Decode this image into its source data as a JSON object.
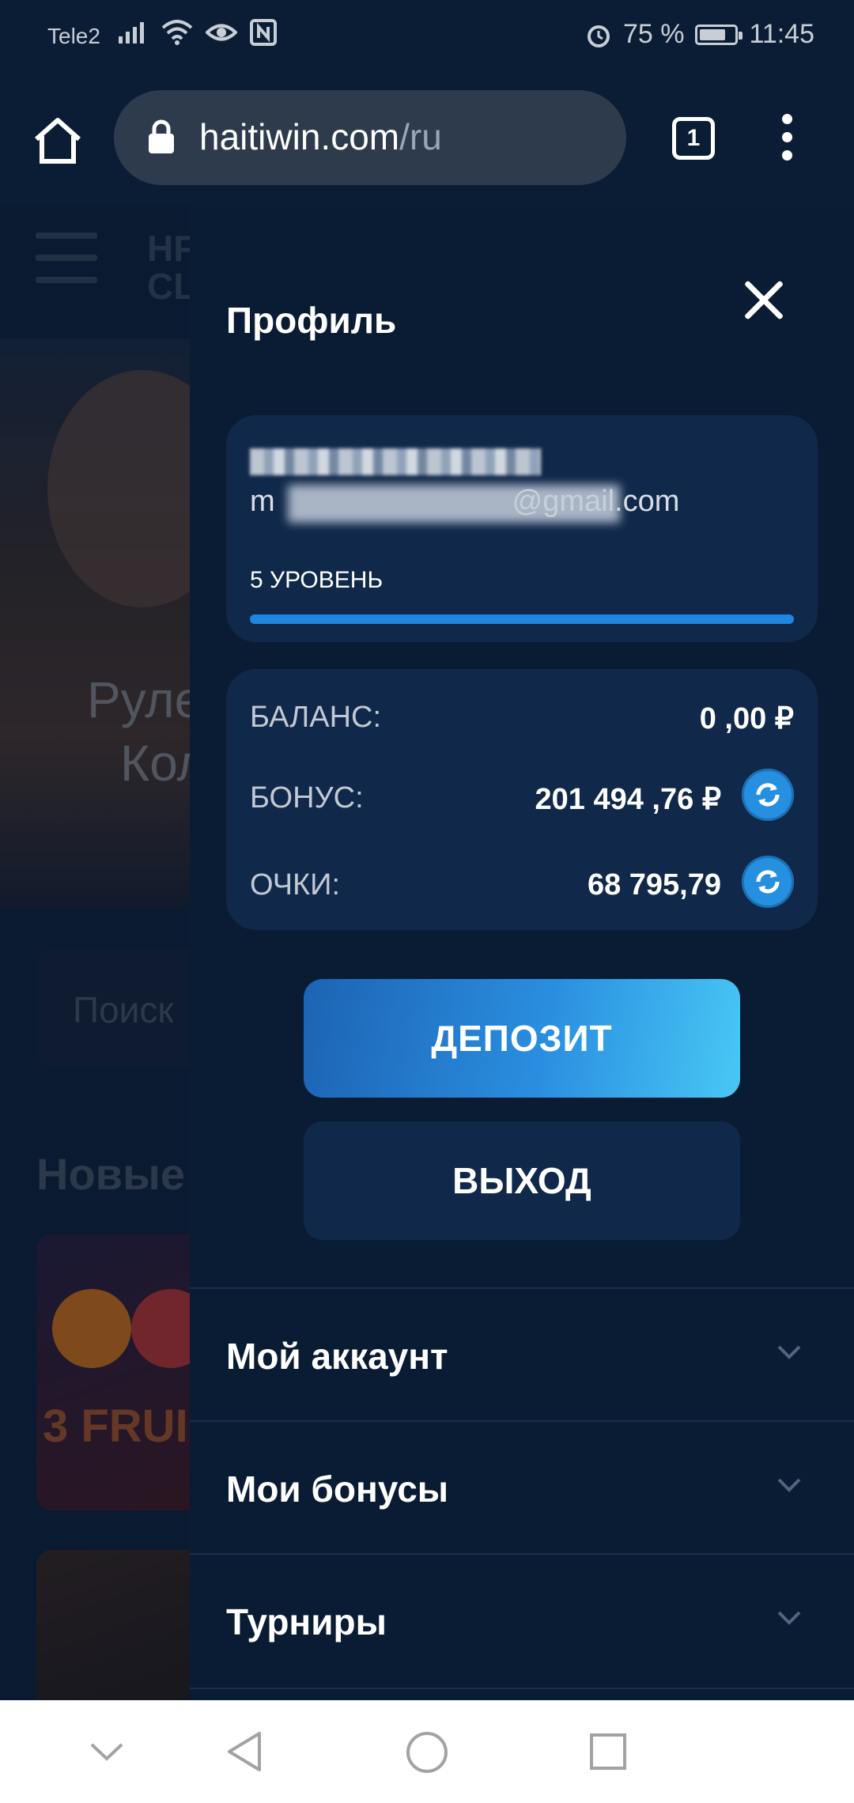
{
  "status_bar": {
    "carrier": "Tele2",
    "battery_percent": "75 %",
    "battery_level": 0.75,
    "time": "11:45",
    "icons": [
      "signal-icon",
      "wifi-icon",
      "eye-icon",
      "nfc-icon",
      "alarm-icon",
      "battery-icon"
    ]
  },
  "browser": {
    "domain": "haitiwin.com",
    "path": "/ru",
    "tab_count": "1"
  },
  "background": {
    "logo_line1": "HF",
    "logo_line2": "CL",
    "banner_line1": "Руле",
    "banner_line2": "Кол",
    "search_placeholder": "Поиск",
    "section_title": "Новые",
    "tile_label": "3 FRUI"
  },
  "panel": {
    "title": "Профиль",
    "user": {
      "email_visible_start": "m",
      "email_visible_end": "@gmail.com",
      "level_label": "5 УРОВЕНЬ",
      "level_progress": 1.0
    },
    "balance": {
      "rows": [
        {
          "label": "БАЛАНС:",
          "value": "0 ,00 ₽",
          "refresh": false
        },
        {
          "label": "БОНУС:",
          "value": "201 494 ,76 ₽",
          "refresh": true
        },
        {
          "label": "ОЧКИ:",
          "value": "68 795,79",
          "refresh": true
        }
      ]
    },
    "deposit_label": "ДЕПОЗИТ",
    "logout_label": "ВЫХОД",
    "menu": [
      {
        "label": "Мой аккаунт"
      },
      {
        "label": "Мои бонусы"
      },
      {
        "label": "Турниры"
      }
    ]
  },
  "colors": {
    "panel_bg": "#0a1c33",
    "card_bg": "#10284a",
    "accent": "#1c86e0",
    "deposit_gradient_end": "#48c8f5"
  }
}
